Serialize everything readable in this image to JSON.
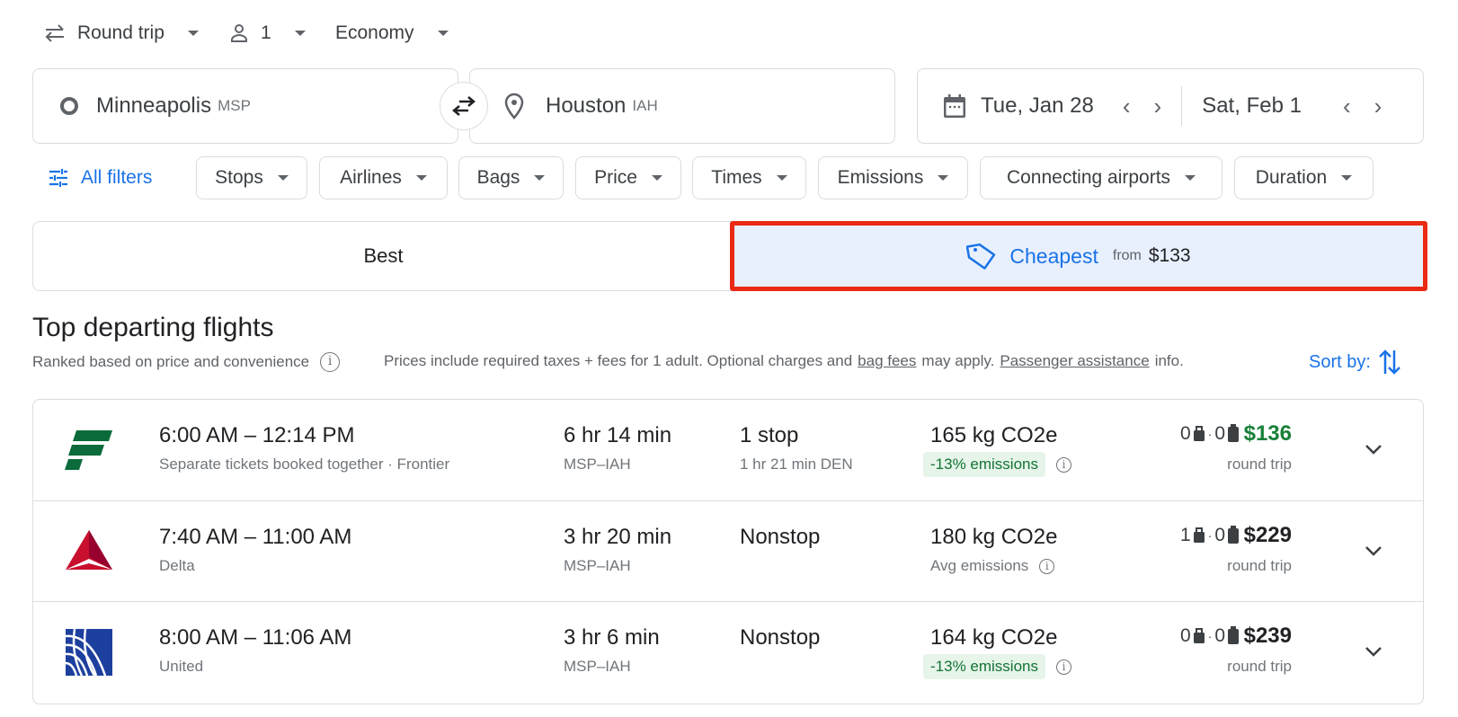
{
  "search": {
    "trip_type": "Round trip",
    "passengers": "1",
    "cabin": "Economy",
    "origin": {
      "city": "Minneapolis",
      "code": "MSP"
    },
    "destination": {
      "city": "Houston",
      "code": "IAH"
    },
    "depart_date": "Tue, Jan 28",
    "return_date": "Sat, Feb 1"
  },
  "filters": {
    "all_filters": "All filters",
    "chips": [
      "Stops",
      "Airlines",
      "Bags",
      "Price",
      "Times",
      "Emissions",
      "Connecting airports",
      "Duration"
    ]
  },
  "tabs": {
    "best": "Best",
    "cheapest": "Cheapest",
    "cheapest_from": "from",
    "cheapest_price": "$133"
  },
  "section": {
    "title": "Top departing flights",
    "ranked": "Ranked based on price and convenience",
    "prices_note_1": "Prices include required taxes + fees for 1 adult. Optional charges and",
    "bag_fees_link": "bag fees",
    "prices_note_2": "may apply.",
    "assistance_link": "Passenger assistance",
    "prices_note_3": "info.",
    "sort_by": "Sort by:"
  },
  "flights": [
    {
      "airline": "Frontier",
      "times": "6:00 AM – 12:14 PM",
      "subtitle": "Separate tickets booked together · Frontier",
      "duration": "6 hr 14 min",
      "route": "MSP–IAH",
      "stops": "1 stop",
      "stop_info": "1 hr 21 min DEN",
      "co2": "165 kg CO2e",
      "emissions": "-13% emissions",
      "carry_on": "0",
      "checked": "0",
      "price": "$136",
      "price_type": "round trip",
      "price_color": "#188038"
    },
    {
      "airline": "Delta",
      "times": "7:40 AM – 11:00 AM",
      "subtitle": "Delta",
      "duration": "3 hr 20 min",
      "route": "MSP–IAH",
      "stops": "Nonstop",
      "stop_info": "",
      "co2": "180 kg CO2e",
      "emissions": "Avg emissions",
      "carry_on": "1",
      "checked": "0",
      "price": "$229",
      "price_type": "round trip"
    },
    {
      "airline": "United",
      "times": "8:00 AM – 11:06 AM",
      "subtitle": "United",
      "duration": "3 hr 6 min",
      "route": "MSP–IAH",
      "stops": "Nonstop",
      "stop_info": "",
      "co2": "164 kg CO2e",
      "emissions": "-13% emissions",
      "carry_on": "0",
      "checked": "0",
      "price": "$239",
      "price_type": "round trip"
    }
  ],
  "colors": {
    "accent": "#1a73e8",
    "highlight_border": "#ea2a14",
    "selected_tab_bg": "#e8f0fe",
    "emission_badge_bg": "#e6f4ea",
    "emission_badge_text": "#137333"
  }
}
